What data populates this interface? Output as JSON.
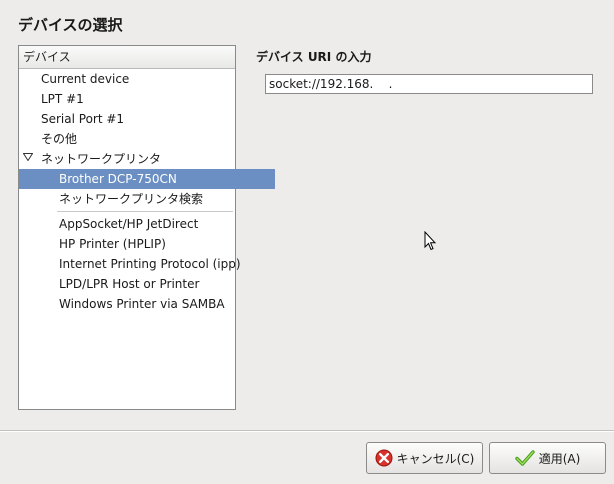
{
  "dialog": {
    "title": "デバイスの選択"
  },
  "device_list": {
    "header": "デバイス",
    "items": [
      {
        "label": "Current device"
      },
      {
        "label": "LPT #1"
      },
      {
        "label": "Serial Port #1"
      },
      {
        "label": "その他"
      },
      {
        "label": "ネットワークプリンタ",
        "expanded": true
      },
      {
        "label": "Brother DCP-750CN",
        "selected": true
      },
      {
        "label": "ネットワークプリンタ検索"
      },
      {
        "label": "AppSocket/HP JetDirect"
      },
      {
        "label": "HP Printer (HPLIP)"
      },
      {
        "label": "Internet Printing Protocol (ipp)"
      },
      {
        "label": "LPD/LPR Host or Printer"
      },
      {
        "label": "Windows Printer via SAMBA"
      }
    ]
  },
  "uri": {
    "label": "デバイス URI の入力",
    "value": "socket://192.168.    ."
  },
  "buttons": {
    "cancel": "キャンセル(C)",
    "apply": "適用(A)"
  },
  "colors": {
    "selection": "#6b8fc2",
    "background": "#edeceb"
  }
}
